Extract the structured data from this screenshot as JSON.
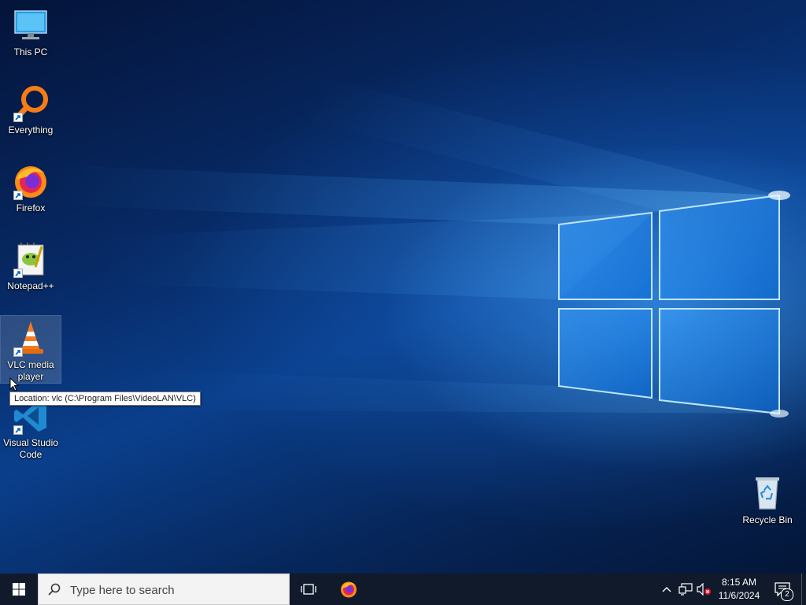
{
  "desktop": {
    "icons": [
      {
        "label": "This PC"
      },
      {
        "label": "Everything"
      },
      {
        "label": "Firefox"
      },
      {
        "label": "Notepad++"
      },
      {
        "label": "VLC media player"
      },
      {
        "label": "Visual Studio Code"
      },
      {
        "label": "Recycle Bin"
      }
    ],
    "tooltip": "Location: vlc (C:\\Program Files\\VideoLAN\\VLC)"
  },
  "taskbar": {
    "search_placeholder": "Type here to search",
    "clock_time": "8:15 AM",
    "clock_date": "11/6/2024",
    "notification_count": "2"
  },
  "colors": {
    "taskbar": "#101a2b",
    "accent": "#0078d7"
  },
  "icons": {
    "start": "windows-logo-icon",
    "search": "search-icon",
    "taskview": "task-view-icon",
    "tray": [
      "chevron-up-icon",
      "network-icon",
      "volume-muted-icon"
    ],
    "notifications": "notification-icon"
  }
}
